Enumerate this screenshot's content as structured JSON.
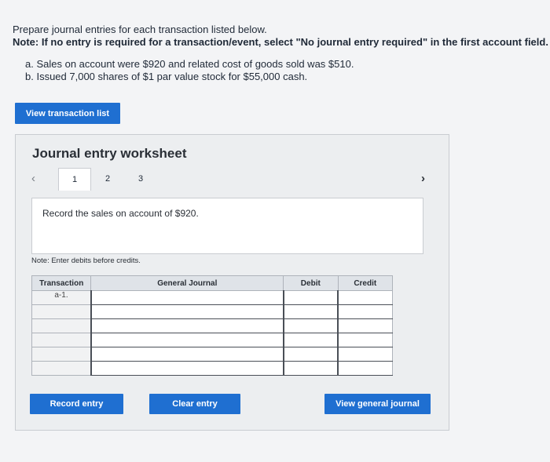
{
  "instructions": {
    "line1": "Prepare journal entries for each transaction listed below.",
    "note": "Note: If no entry is required for a transaction/event, select \"No journal entry required\" in the first account field."
  },
  "transactions": [
    "a. Sales on account were $920 and related cost of goods sold was $510.",
    "b. Issued 7,000 shares of $1 par value stock for $55,000 cash."
  ],
  "view_transaction_list_label": "View transaction list",
  "worksheet": {
    "title": "Journal entry worksheet",
    "prev_icon": "‹",
    "next_icon": "›",
    "steps": [
      "1",
      "2",
      "3"
    ],
    "description": "Record the sales on account of $920.",
    "note": "Note: Enter debits before credits.",
    "table": {
      "headers": [
        "Transaction",
        "General Journal",
        "Debit",
        "Credit"
      ],
      "rows": [
        {
          "transaction": "a-1."
        },
        {
          "transaction": ""
        },
        {
          "transaction": ""
        },
        {
          "transaction": ""
        },
        {
          "transaction": ""
        },
        {
          "transaction": ""
        }
      ]
    },
    "buttons": {
      "record": "Record entry",
      "clear": "Clear entry",
      "view_journal": "View general journal"
    }
  }
}
